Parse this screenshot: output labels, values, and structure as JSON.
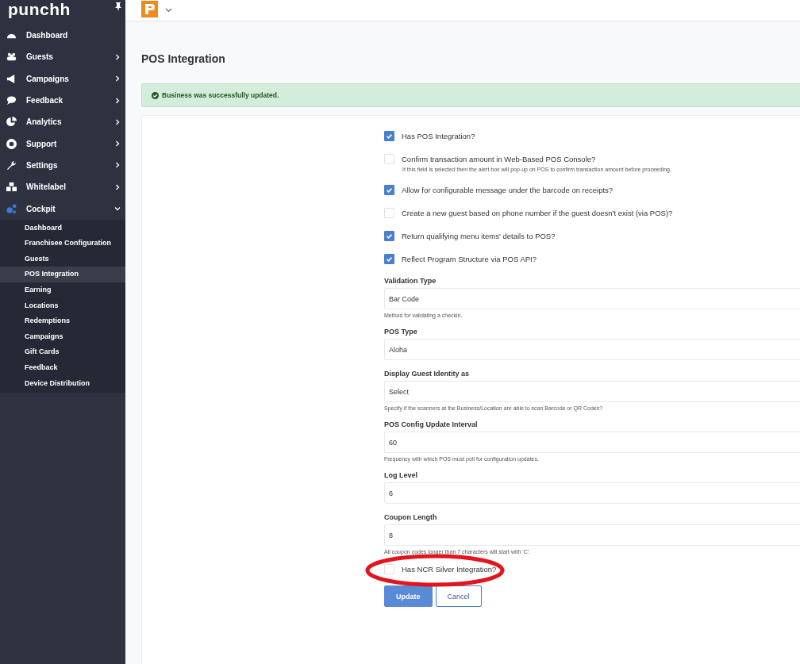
{
  "sidebar": {
    "logo": "punchh",
    "items": [
      {
        "label": "Dashboard",
        "expandable": false,
        "expanded": false,
        "selected": false
      },
      {
        "label": "Guests",
        "expandable": true,
        "expanded": false,
        "selected": false
      },
      {
        "label": "Campaigns",
        "expandable": true,
        "expanded": false,
        "selected": false
      },
      {
        "label": "Feedback",
        "expandable": true,
        "expanded": false,
        "selected": false
      },
      {
        "label": "Analytics",
        "expandable": true,
        "expanded": false,
        "selected": false
      },
      {
        "label": "Support",
        "expandable": true,
        "expanded": false,
        "selected": false
      },
      {
        "label": "Settings",
        "expandable": true,
        "expanded": false,
        "selected": false
      },
      {
        "label": "Whitelabel",
        "expandable": true,
        "expanded": false,
        "selected": false
      },
      {
        "label": "Cockpit",
        "expandable": true,
        "expanded": true,
        "selected": true,
        "children": [
          {
            "label": "Dashboard",
            "selected": false
          },
          {
            "label": "Franchisee Configuration",
            "selected": false
          },
          {
            "label": "Guests",
            "selected": false
          },
          {
            "label": "POS Integration",
            "selected": true
          },
          {
            "label": "Earning",
            "selected": false
          },
          {
            "label": "Locations",
            "selected": false
          },
          {
            "label": "Redemptions",
            "selected": false
          },
          {
            "label": "Campaigns",
            "selected": false
          },
          {
            "label": "Gift Cards",
            "selected": false
          },
          {
            "label": "Feedback",
            "selected": false
          },
          {
            "label": "Device Distribution",
            "selected": false
          }
        ]
      }
    ]
  },
  "page_title": "POS Integration",
  "alert": "Business was successfully updated.",
  "form": {
    "items": [
      {
        "kind": "checkbox",
        "label": "Has POS Integration?",
        "checked": true
      },
      {
        "kind": "checkbox",
        "label": "Confirm transaction amount in Web-Based POS Console?",
        "checked": false,
        "hint": "If this field is selected then the alert box will pop-up on POS to confirm transaction amount before proceeding."
      },
      {
        "kind": "checkbox",
        "label": "Allow for configurable message under the barcode on receipts?",
        "checked": true
      },
      {
        "kind": "checkbox",
        "label": "Create a new guest based on phone number if the guest doesn't exist (via POS)?",
        "checked": false
      },
      {
        "kind": "checkbox",
        "label": "Return qualifying menu items' details to POS?",
        "checked": true
      },
      {
        "kind": "checkbox",
        "label": "Reflect Program Structure via POS API?",
        "checked": true
      },
      {
        "kind": "field",
        "label": "Validation Type",
        "value": "Bar Code",
        "hint": "Method for validating a checkin."
      },
      {
        "kind": "field",
        "label": "POS Type",
        "value": "Aloha"
      },
      {
        "kind": "field",
        "label": "Display Guest Identity as",
        "value": "Select",
        "hint": "Specify if the scanners at the Business/Location are able to scan Barcode or QR Codes?"
      },
      {
        "kind": "field",
        "label": "POS Config Update Interval",
        "value": "60",
        "hint": "Frequency with which POS must poll for configuration updates."
      },
      {
        "kind": "field",
        "label": "Log Level",
        "value": "6"
      },
      {
        "kind": "field",
        "label": "Coupon Length",
        "value": "8",
        "hint": "All coupon codes longer than 7 characters will start with 'C'."
      },
      {
        "kind": "checkbox",
        "label": "Has NCR Silver Integration?",
        "checked": false,
        "highlighted": true
      }
    ],
    "buttons": [
      {
        "label": "Update",
        "kind": "primary"
      },
      {
        "label": "Cancel",
        "kind": "secondary"
      }
    ]
  }
}
